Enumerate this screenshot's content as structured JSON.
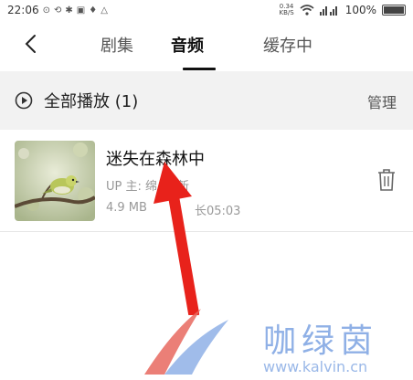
{
  "status_bar": {
    "time": "22:06",
    "net_speed_value": "0.34",
    "net_speed_unit": "KB/S",
    "battery": "100%"
  },
  "header": {
    "tabs": [
      {
        "label": "剧集"
      },
      {
        "label": "音频"
      },
      {
        "label": "缓存中"
      }
    ],
    "active_tab": "音频"
  },
  "play_all": {
    "label": "全部播放 (1)",
    "manage_label": "管理"
  },
  "items": [
    {
      "title": "迷失在森林中",
      "uploader": "UP 主: 绵",
      "uploader_tail": "新",
      "size": "4.9 MB",
      "duration": "长05:03"
    }
  ],
  "watermark": {
    "text": "咖绿茵",
    "url": "www.kalvin.cn"
  },
  "colors": {
    "arrow": "#e8221b",
    "watermark_blue": "#8fb0e6",
    "watermark_red": "#e8695f",
    "active_tab": "#111111"
  }
}
